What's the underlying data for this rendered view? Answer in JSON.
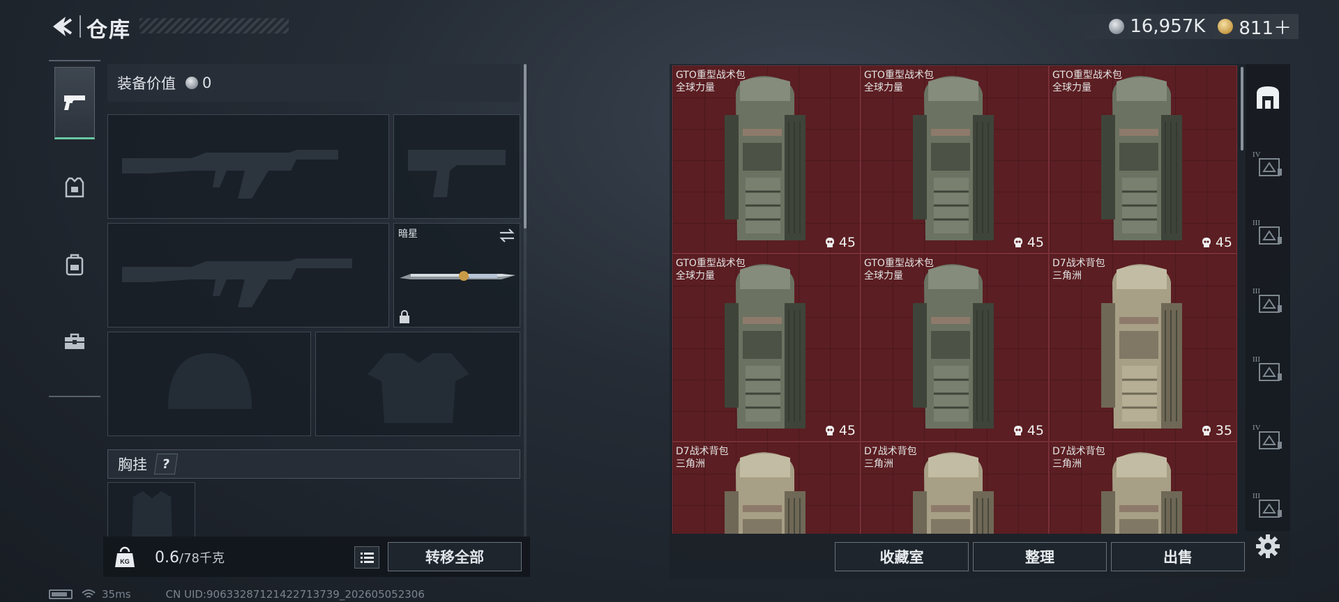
{
  "header": {
    "title": "仓库",
    "currency_silver": "16,957K",
    "currency_gold": "811＋"
  },
  "sidebar": {
    "tabs": [
      {
        "name": "weapons",
        "icon": "pistol-icon",
        "active": true
      },
      {
        "name": "armor",
        "icon": "armor-vest-icon",
        "active": false
      },
      {
        "name": "backpack",
        "icon": "backpack-icon",
        "active": false
      },
      {
        "name": "supplies",
        "icon": "toolbox-icon",
        "active": false
      }
    ]
  },
  "equipment": {
    "value_label": "装备价值",
    "value": "0",
    "melee_name": "暗星",
    "chest_label": "胸挂",
    "chest_help": "?"
  },
  "weight": {
    "icon_text": "KG",
    "current": "0.6",
    "max": "/78千克"
  },
  "buttons": {
    "transfer_all": "转移全部",
    "collection": "收藏室",
    "organize": "整理",
    "sell": "出售"
  },
  "status": {
    "ping": "35ms",
    "uid": "CN UID:9063328712142271373​9_202605052306"
  },
  "storage": {
    "items": [
      {
        "name": "GTO重型战术包",
        "sub": "全球力量",
        "count": "45",
        "tone": "green"
      },
      {
        "name": "GTO重型战术包",
        "sub": "全球力量",
        "count": "45",
        "tone": "green"
      },
      {
        "name": "GTO重型战术包",
        "sub": "全球力量",
        "count": "45",
        "tone": "green"
      },
      {
        "name": "GTO重型战术包",
        "sub": "全球力量",
        "count": "45",
        "tone": "green"
      },
      {
        "name": "GTO重型战术包",
        "sub": "全球力量",
        "count": "45",
        "tone": "green"
      },
      {
        "name": "D7战术背包",
        "sub": "三角洲",
        "count": "35",
        "tone": "tan"
      },
      {
        "name": "D7战术背包",
        "sub": "三角洲",
        "count": "",
        "tone": "tan"
      },
      {
        "name": "D7战术背包",
        "sub": "三角洲",
        "count": "",
        "tone": "tan"
      },
      {
        "name": "D7战术背包",
        "sub": "三角洲",
        "count": "",
        "tone": "tan"
      }
    ]
  },
  "filters": [
    {
      "icon": "all-items-icon",
      "tier": ""
    },
    {
      "icon": "case-tier-icon",
      "tier": "IV"
    },
    {
      "icon": "case-tier-icon",
      "tier": "III"
    },
    {
      "icon": "case-tier-icon",
      "tier": "III"
    },
    {
      "icon": "case-tier-icon",
      "tier": "III"
    },
    {
      "icon": "case-tier-icon",
      "tier": "IV"
    },
    {
      "icon": "case-tier-icon",
      "tier": "III"
    }
  ],
  "colors": {
    "accent": "#69c8a6",
    "item_bg": "#5b1e22"
  }
}
